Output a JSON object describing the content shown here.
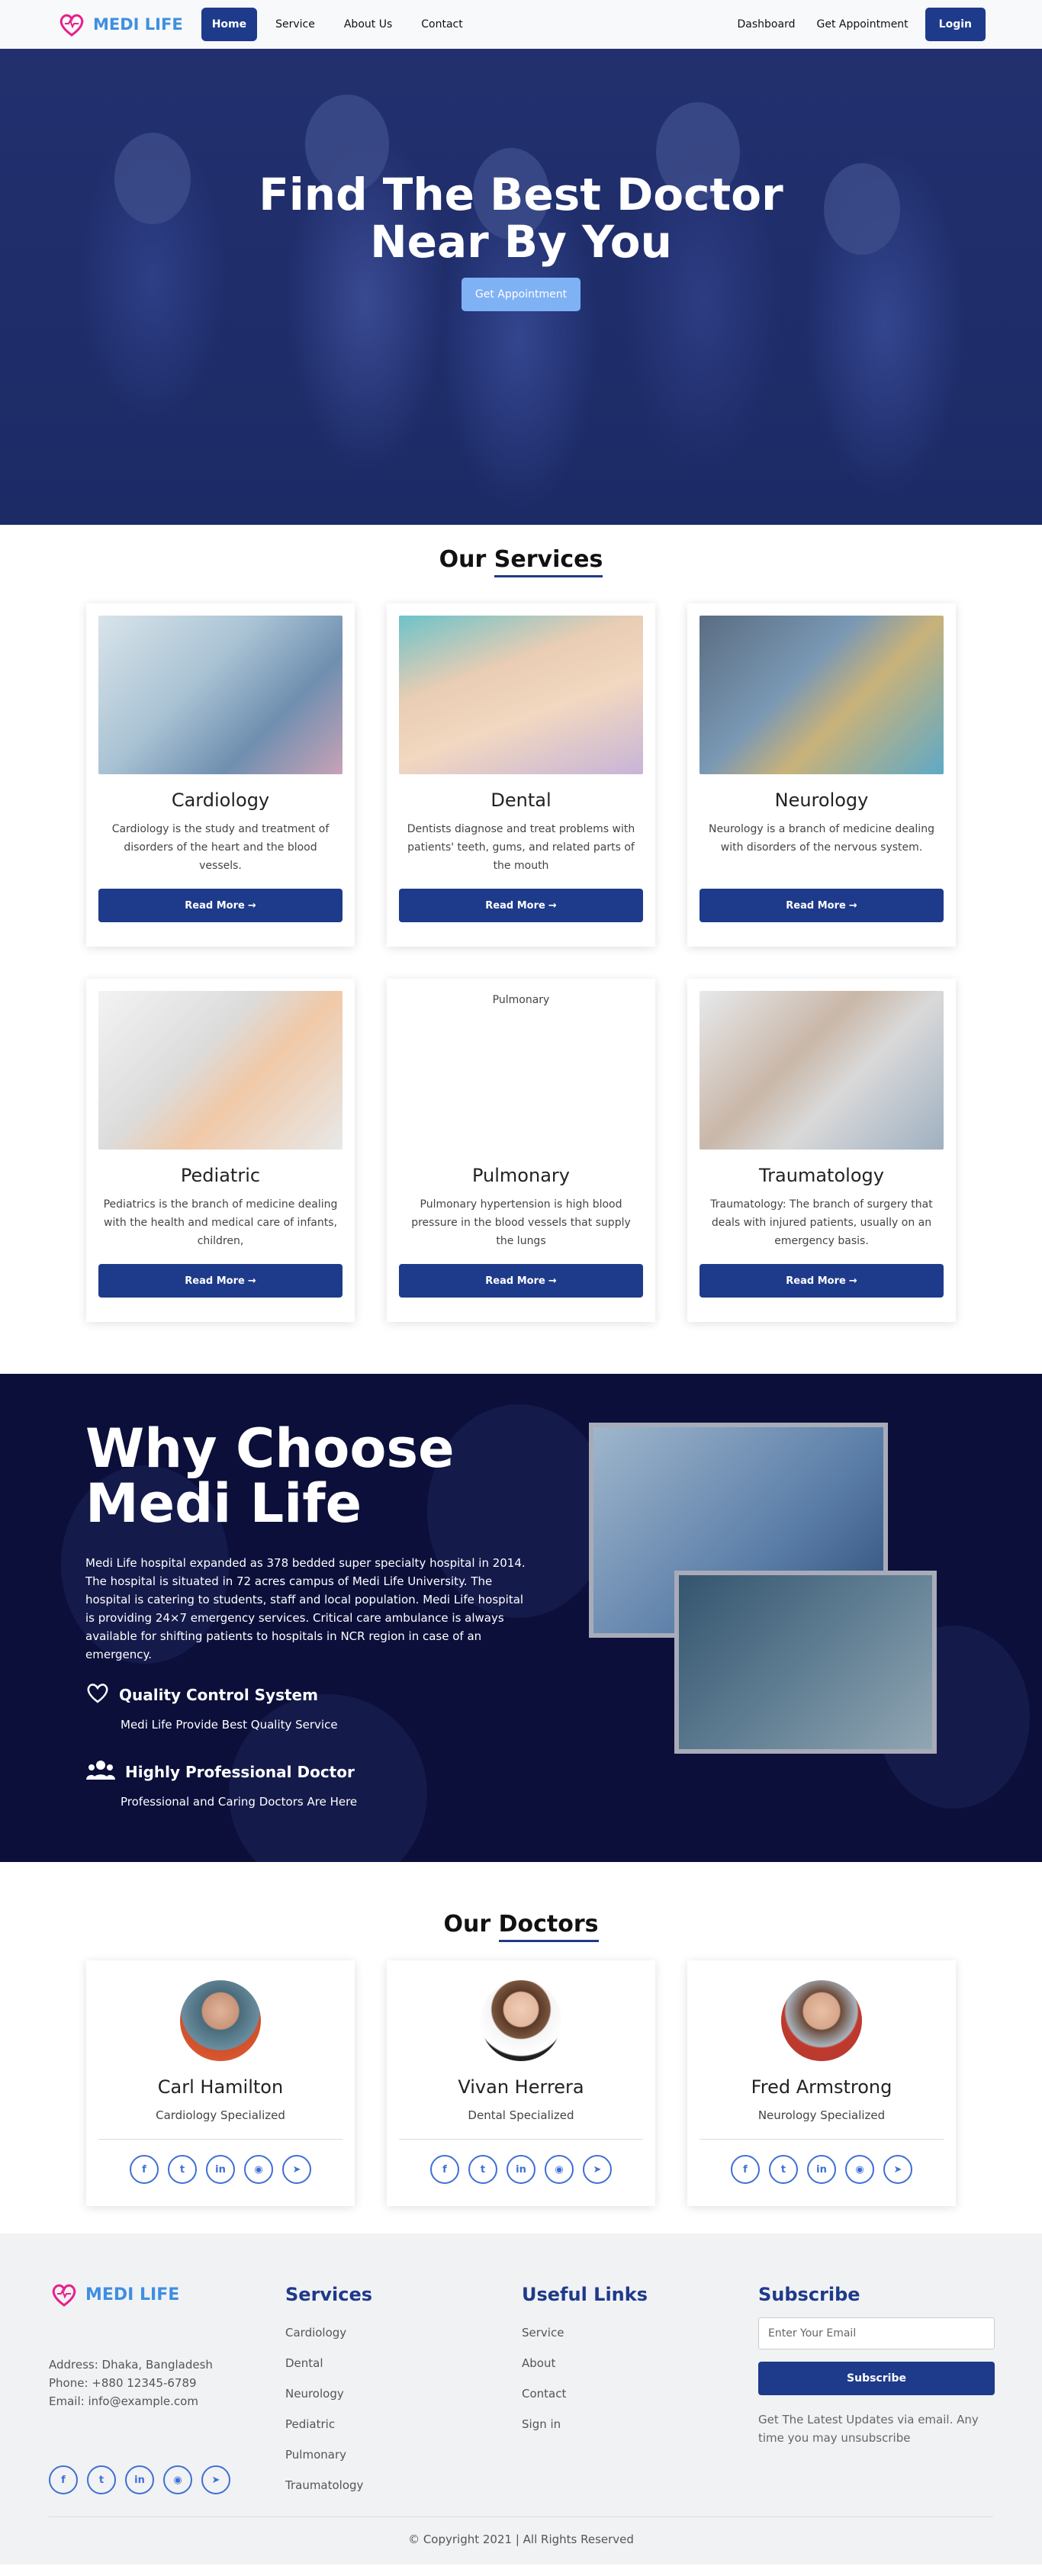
{
  "nav": {
    "brand": "MEDI LIFE",
    "links": [
      "Home",
      "Service",
      "About Us",
      "Contact"
    ],
    "right_links": [
      "Dashboard",
      "Get Appointment"
    ],
    "login": "Login"
  },
  "hero": {
    "title_line1": "Find The Best Doctor",
    "title_line2": "Near By You",
    "button": "Get Appointment"
  },
  "services": {
    "title_plain": "Our ",
    "title_underlined": "Services",
    "read_more": "Read More",
    "items": [
      {
        "name": "Cardiology",
        "description": "Cardiology is the study and treatment of disorders of the heart and the blood vessels.",
        "image_alt": ""
      },
      {
        "name": "Dental",
        "description": "Dentists diagnose and treat problems with patients' teeth, gums, and related parts of the mouth",
        "image_alt": ""
      },
      {
        "name": "Neurology",
        "description": "Neurology is a branch of medicine dealing with disorders of the nervous system.",
        "image_alt": ""
      },
      {
        "name": "Pediatric",
        "description": "Pediatrics is the branch of medicine dealing with the health and medical care of infants, children,",
        "image_alt": ""
      },
      {
        "name": "Pulmonary",
        "description": "Pulmonary hypertension is high blood pressure in the blood vessels that supply the lungs",
        "image_alt": "Pulmonary"
      },
      {
        "name": "Traumatology",
        "description": "Traumatology: The branch of surgery that deals with injured patients, usually on an emergency basis.",
        "image_alt": ""
      }
    ]
  },
  "why": {
    "title_line1": "Why Choose",
    "title_line2": "Medi Life",
    "description": "Medi Life hospital expanded as 378 bedded super specialty hospital in 2014. The hospital is situated in 72 acres campus of Medi Life University. The hospital is catering to students, staff and local population. Medi Life hospital is providing 24×7 emergency services. Critical care ambulance is always available for shifting patients to hospitals in NCR region in case of an emergency.",
    "features": [
      {
        "title": "Quality Control System",
        "subtitle": "Medi Life Provide Best Quality Service",
        "icon": "heart-icon"
      },
      {
        "title": "Highly Professional Doctor",
        "subtitle": "Professional and Caring Doctors Are Here",
        "icon": "users-icon"
      }
    ]
  },
  "doctors": {
    "title_plain": "Our ",
    "title_underlined": "Doctors",
    "items": [
      {
        "name": "Carl Hamilton",
        "specialty": "Cardiology Specialized"
      },
      {
        "name": "Vivan Herrera",
        "specialty": "Dental Specialized"
      },
      {
        "name": "Fred Armstrong",
        "specialty": "Neurology Specialized"
      }
    ],
    "social_icons": [
      "facebook-icon",
      "twitter-icon",
      "linkedin-icon",
      "instagram-icon",
      "telegram-icon"
    ]
  },
  "footer": {
    "brand": "MEDI LIFE",
    "address": "Address: Dhaka, Bangladesh",
    "phone": "Phone: +880 12345-6789",
    "email": "Email: info@example.com",
    "services_title": "Services",
    "services": [
      "Cardiology",
      "Dental",
      "Neurology",
      "Pediatric",
      "Pulmonary",
      "Traumatology"
    ],
    "links_title": "Useful Links",
    "links": [
      "Service",
      "About",
      "Contact",
      "Sign in"
    ],
    "subscribe_title": "Subscribe",
    "email_placeholder": "Enter Your Email",
    "subscribe_button": "Subscribe",
    "subscribe_note": "Get The Latest Updates via email. Any time you may unsubscribe",
    "copyright": "© Copyright 2021 | All Rights Reserved"
  },
  "colors": {
    "primary": "#1e3a8a",
    "brand": "#3f8fe0",
    "hero_button": "#7fb1f5",
    "dark_section": "#0b0f3a"
  }
}
